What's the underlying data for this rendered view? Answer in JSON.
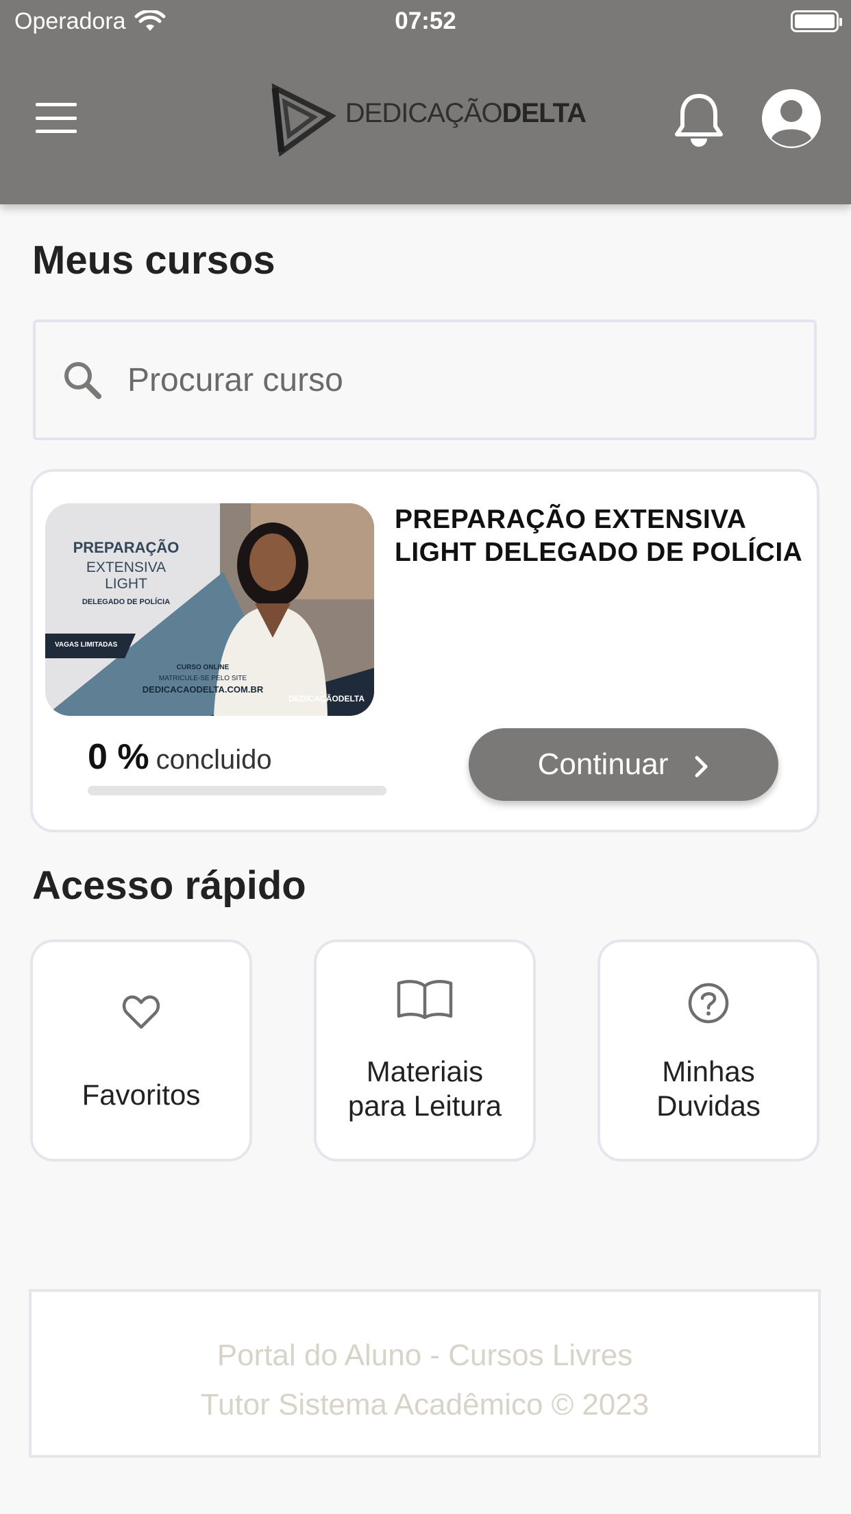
{
  "status_bar": {
    "carrier": "Operadora",
    "time": "07:52"
  },
  "header": {
    "logo_text_light": "DEDICAÇÃO",
    "logo_text_bold": "DELTA"
  },
  "my_courses": {
    "title": "Meus cursos",
    "search_placeholder": "Procurar curso"
  },
  "course": {
    "title": "PREPARAÇÃO EXTENSIVA LIGHT DELEGADO DE POLÍCIA",
    "thumbnail": {
      "line1": "PREPARAÇÃO",
      "line2": "EXTENSIVA",
      "line3": "LIGHT",
      "line4": "DELEGADO DE POLÍCIA",
      "badge": "VAGAS LIMITADAS",
      "online": "CURSO ONLINE",
      "enroll": "MATRICULE-SE PELO SITE",
      "site": "DEDICACAODELTA.COM.BR",
      "mini_logo": "DEDICAÇÃODELTA"
    },
    "progress_value": "0 %",
    "progress_label": "concluido",
    "progress_fraction": 0,
    "continue_label": "Continuar"
  },
  "quick_access": {
    "title": "Acesso rápido",
    "items": [
      {
        "label": "Favoritos",
        "icon": "heart-icon"
      },
      {
        "label_line1": "Materiais",
        "label_line2": "para Leitura",
        "icon": "book-icon"
      },
      {
        "label_line1": "Minhas",
        "label_line2": "Duvidas",
        "icon": "question-circle-icon"
      }
    ]
  },
  "footer": {
    "line1": "Portal do Aluno - Cursos Livres",
    "line2": "Tutor Sistema Acadêmico © 2023"
  },
  "colors": {
    "header_bg": "#7a7978",
    "page_bg": "#f8f8f9",
    "card_border": "#e6e5ee",
    "footer_text": "#d7d3c8"
  }
}
